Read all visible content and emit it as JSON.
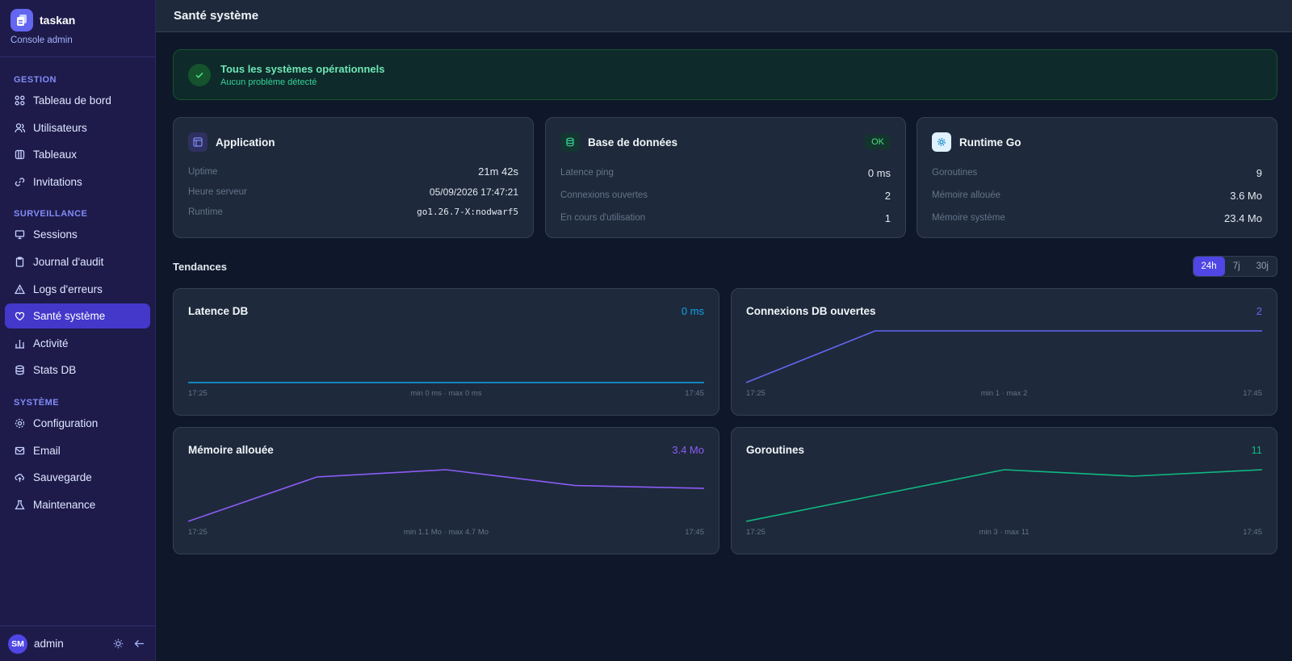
{
  "app": {
    "name": "taskan",
    "subtitle": "Console admin"
  },
  "sidebar": {
    "sections": [
      {
        "label": "GESTION",
        "items": [
          "Tableau de bord",
          "Utilisateurs",
          "Tableaux",
          "Invitations"
        ]
      },
      {
        "label": "SURVEILLANCE",
        "items": [
          "Sessions",
          "Journal d'audit",
          "Logs d'erreurs",
          "Santé système",
          "Activité",
          "Stats DB"
        ]
      },
      {
        "label": "SYSTÈME",
        "items": [
          "Configuration",
          "Email",
          "Sauvegarde",
          "Maintenance"
        ]
      }
    ],
    "active_item": "Santé système",
    "footer": {
      "initials": "SM",
      "user": "admin"
    }
  },
  "page": {
    "title": "Santé système"
  },
  "banner": {
    "title": "Tous les systèmes opérationnels",
    "subtitle": "Aucun problème détecté"
  },
  "cards": {
    "app": {
      "title": "Application",
      "rows": [
        {
          "k": "Uptime",
          "v": "21m 42s"
        },
        {
          "k": "Heure serveur",
          "v": "05/09/2026 17:47:21"
        },
        {
          "k": "Runtime",
          "v": "go1.26.7-X:nodwarf5"
        }
      ]
    },
    "db": {
      "title": "Base de données",
      "badge": "OK",
      "rows": [
        {
          "k": "Latence ping",
          "v": "0 ms"
        },
        {
          "k": "Connexions ouvertes",
          "v": "2"
        },
        {
          "k": "En cours d'utilisation",
          "v": "1"
        }
      ]
    },
    "go": {
      "title": "Runtime Go",
      "rows": [
        {
          "k": "Goroutines",
          "v": "9"
        },
        {
          "k": "Mémoire allouée",
          "v": "3.6 Mo"
        },
        {
          "k": "Mémoire système",
          "v": "23.4 Mo"
        }
      ]
    }
  },
  "trends": {
    "title": "Tendances",
    "ranges": [
      "24h",
      "7j",
      "30j"
    ],
    "selected": "24h"
  },
  "colors": {
    "accent": "#4f46e5",
    "ok": "#4ade80",
    "blue": "#0ea5e9",
    "indigo": "#6366f1",
    "purple": "#8b5cf6",
    "green": "#10b981"
  },
  "chart_data": [
    {
      "type": "line",
      "title": "Latence DB",
      "current": "0 ms",
      "x": [
        "17:25",
        "17:45"
      ],
      "values": [
        0,
        0
      ],
      "range_label": "min 0 ms · max 0 ms",
      "ylim": [
        0,
        1
      ],
      "color": "#0ea5e9"
    },
    {
      "type": "line",
      "title": "Connexions DB ouvertes",
      "current": "2",
      "x": [
        "17:25",
        "17:45"
      ],
      "values": [
        1,
        2,
        2,
        2,
        2
      ],
      "range_label": "min 1 · max 2",
      "ylim": [
        1,
        2
      ],
      "color": "#6366f1"
    },
    {
      "type": "line",
      "title": "Mémoire allouée",
      "current": "3.4 Mo",
      "x": [
        "17:25",
        "17:45"
      ],
      "values": [
        1.1,
        4.2,
        4.7,
        3.6,
        3.4
      ],
      "range_label": "min 1.1 Mo · max 4.7 Mo",
      "ylim": [
        1.1,
        4.7
      ],
      "color": "#8b5cf6"
    },
    {
      "type": "line",
      "title": "Goroutines",
      "current": "11",
      "x": [
        "17:25",
        "17:45"
      ],
      "values": [
        3,
        7,
        11,
        10,
        11
      ],
      "range_label": "min 3 · max 11",
      "ylim": [
        3,
        11
      ],
      "color": "#10b981"
    }
  ]
}
